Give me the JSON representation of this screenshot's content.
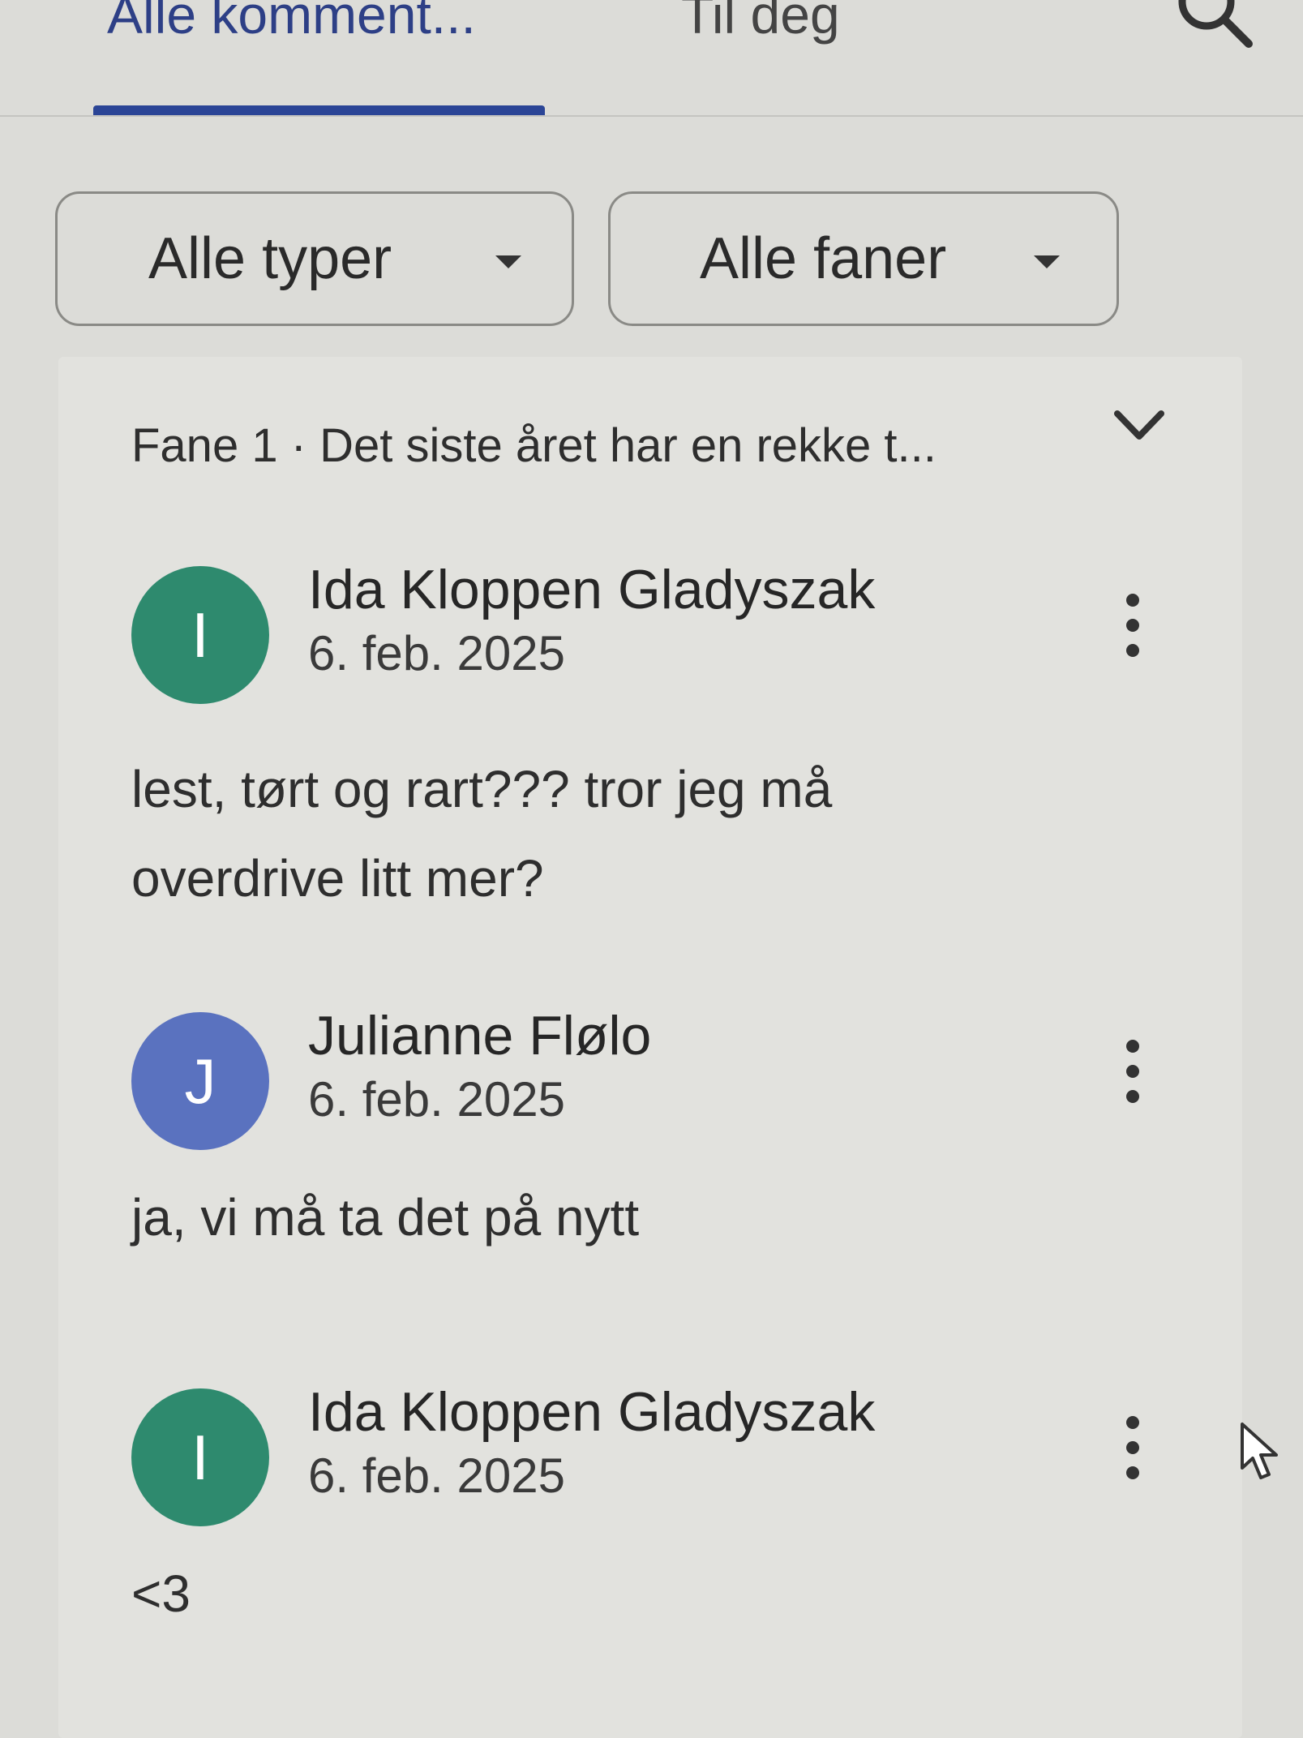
{
  "tabs": {
    "all_comments": "Alle komment...",
    "for_you": "Til deg",
    "active": "all_comments"
  },
  "filters": {
    "types": "Alle typer",
    "tabs": "Alle faner"
  },
  "thread": {
    "title": "Fane 1 · Det siste året har en rekke t..."
  },
  "comments": [
    {
      "initial": "I",
      "avatar_color": "#2e8a6e",
      "author": "Ida Kloppen Gladyszak",
      "date": "6. feb. 2025",
      "lines": [
        "lest, tørt og rart??? tror jeg må",
        "overdrive litt mer?"
      ]
    },
    {
      "initial": "J",
      "avatar_color": "#5a72bf",
      "author": "Julianne Flølo",
      "date": "6. feb. 2025",
      "lines": [
        "ja, vi må ta det på nytt"
      ]
    },
    {
      "initial": "I",
      "avatar_color": "#2e8a6e",
      "author": "Ida Kloppen Gladyszak",
      "date": "6. feb. 2025",
      "lines": [
        "<3"
      ]
    }
  ],
  "colors": {
    "accent": "#2b4596",
    "background": "#dcdcd8"
  },
  "icons": {
    "search": "search-icon",
    "dropdown": "caret-down-icon",
    "collapse": "chevron-down-icon",
    "more": "more-vertical-icon",
    "cursor": "mouse-pointer-icon"
  }
}
